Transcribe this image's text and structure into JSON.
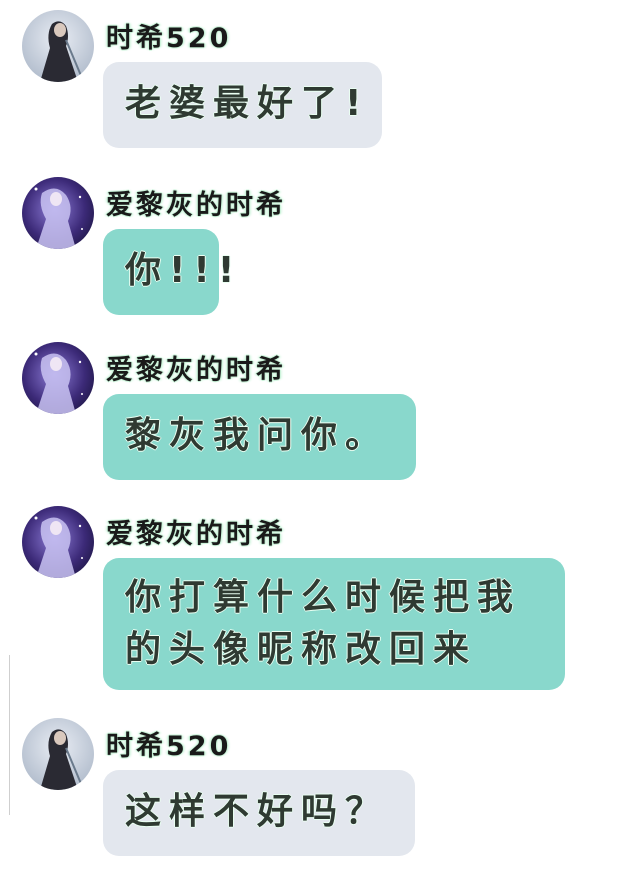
{
  "messages": [
    {
      "sender": "时希520",
      "text": "老婆最好了!",
      "style": "grey",
      "avatar": "avatar-dark-cape"
    },
    {
      "sender": "爱黎灰的时希",
      "text": "你!!!",
      "style": "teal",
      "avatar": "avatar-purple-figure"
    },
    {
      "sender": "爱黎灰的时希",
      "text": "黎灰我问你。",
      "style": "teal",
      "avatar": "avatar-purple-figure"
    },
    {
      "sender": "爱黎灰的时希",
      "text_line1": "你打算什么时候把我",
      "text_line2": "的头像昵称改回来",
      "style": "teal",
      "avatar": "avatar-purple-figure"
    },
    {
      "sender": "时希520",
      "text": "这样不好吗？",
      "style": "grey",
      "avatar": "avatar-dark-cape"
    }
  ],
  "colors": {
    "bubble_grey": "#e3e7ee",
    "bubble_teal": "#89d8cc",
    "text": "#2f3a32"
  }
}
